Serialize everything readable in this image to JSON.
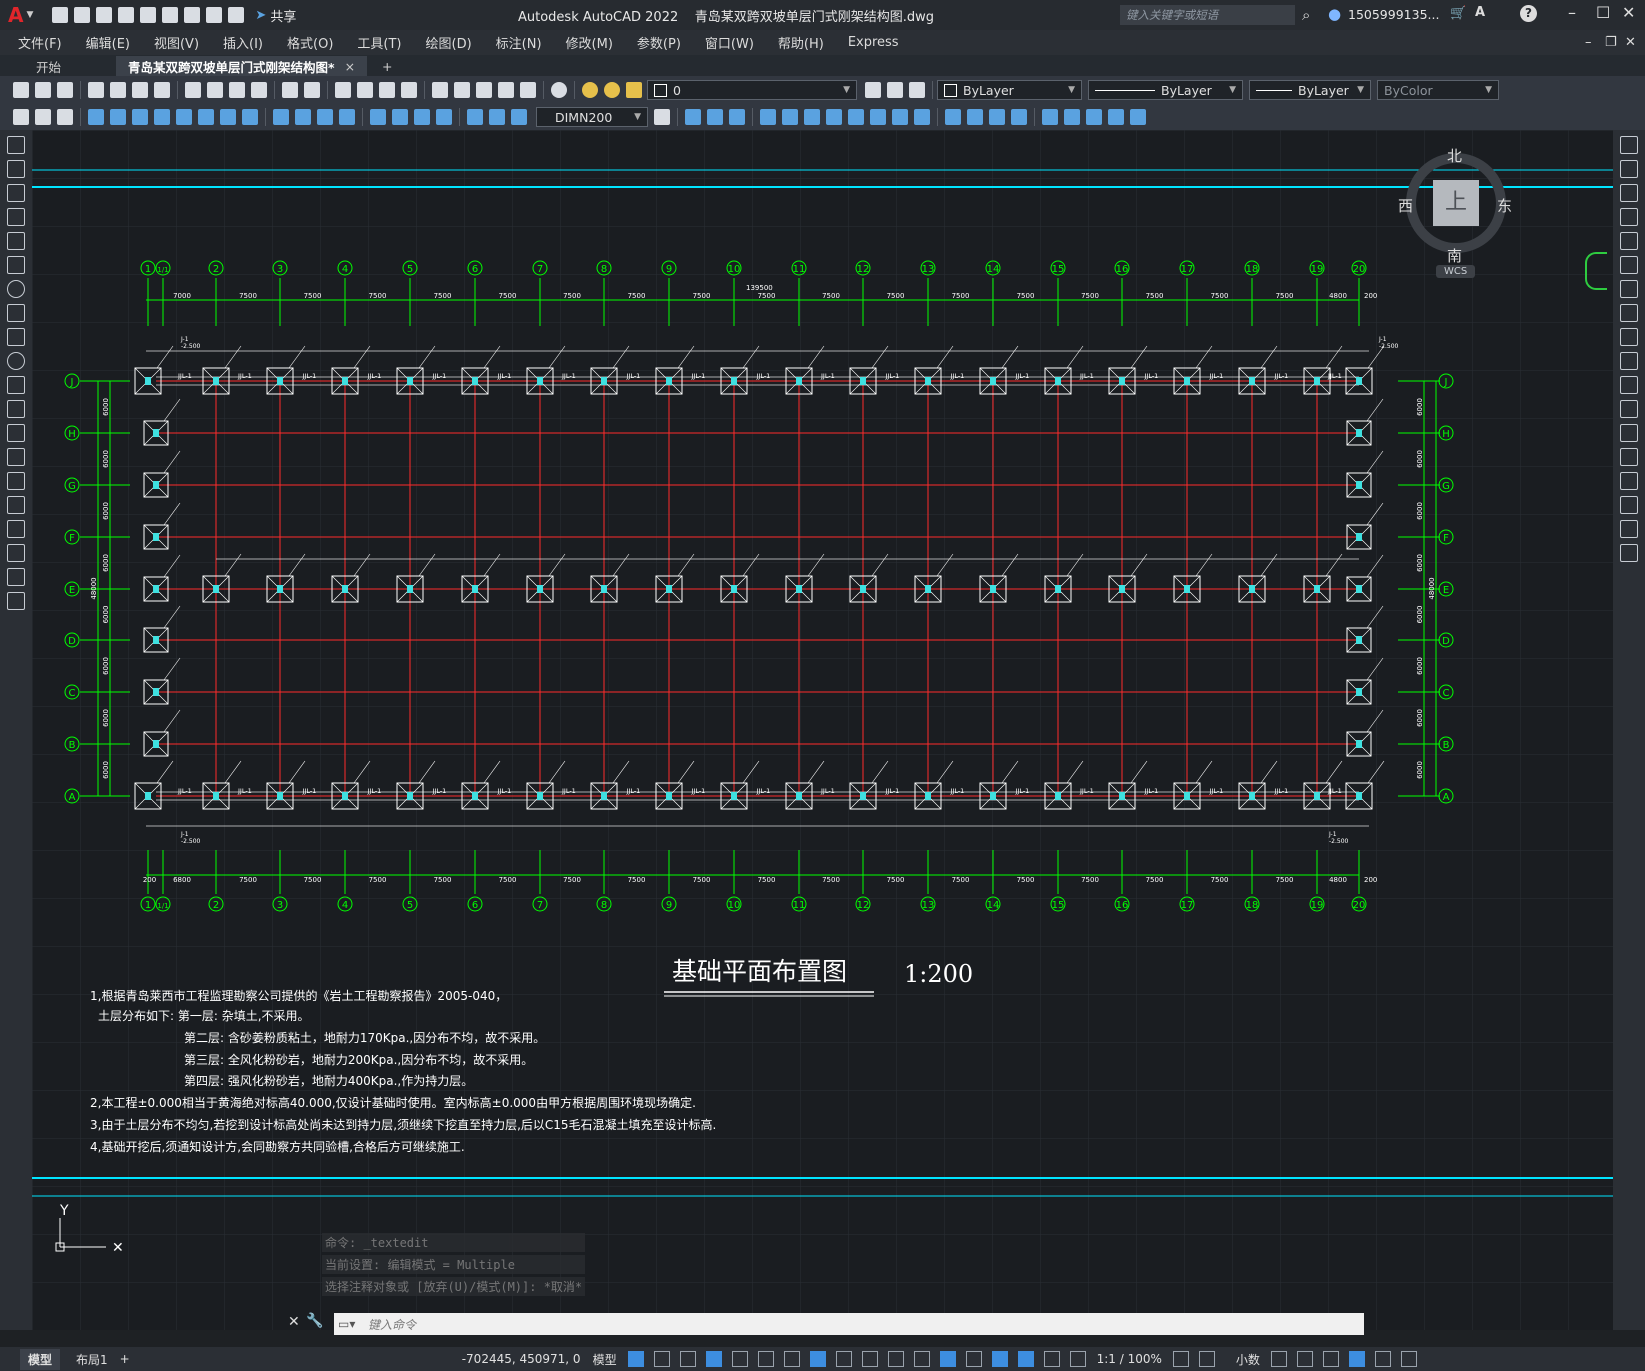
{
  "titlebar": {
    "app_logo": "A",
    "share_label": "共享",
    "title": "Autodesk AutoCAD 2022    青岛某双跨双坡单层门式刚架结构图.dwg",
    "search_placeholder": "键入关键字或短语",
    "user": "1505999135...",
    "help": "?"
  },
  "menubar": {
    "items": [
      "文件(F)",
      "编辑(E)",
      "视图(V)",
      "插入(I)",
      "格式(O)",
      "工具(T)",
      "绘图(D)",
      "标注(N)",
      "修改(M)",
      "参数(P)",
      "窗口(W)",
      "帮助(H)",
      "Express"
    ]
  },
  "tabs": [
    {
      "label": "开始"
    },
    {
      "label": "青岛某双跨双坡单层门式刚架结构图*"
    }
  ],
  "tab_close": "×",
  "tab_add": "+",
  "toolbar": {
    "layer_value": "0",
    "color_value": "ByLayer",
    "linetype_value": "ByLayer",
    "lineweight_value": "ByLayer",
    "plotstyle_value": "ByColor",
    "dimstyle_value": "DIMN200"
  },
  "viewcube": {
    "north": "北",
    "south": "南",
    "east": "东",
    "west": "西",
    "top": "上",
    "wcs": "WCS"
  },
  "drawing": {
    "title": "基础平面布置图",
    "scale": "1:200",
    "total_dim": "139500",
    "grid_columns": [
      "1",
      "1/1",
      "2",
      "3",
      "4",
      "5",
      "6",
      "7",
      "8",
      "9",
      "10",
      "11",
      "12",
      "13",
      "14",
      "15",
      "16",
      "17",
      "18",
      "19",
      "20"
    ],
    "grid_rows": [
      "J",
      "H",
      "G",
      "F",
      "E",
      "D",
      "C",
      "B",
      "A"
    ],
    "top_spans": [
      "7000",
      "7500",
      "7500",
      "7500",
      "7500",
      "7500",
      "7500",
      "7500",
      "7500",
      "7500",
      "7500",
      "7500",
      "7500",
      "7500",
      "7500",
      "7500",
      "7500",
      "7500",
      "4800",
      "200"
    ],
    "bottom_spans": [
      "200",
      "6800",
      "7500",
      "7500",
      "7500",
      "7500",
      "7500",
      "7500",
      "7500",
      "7500",
      "7500",
      "7500",
      "7500",
      "7500",
      "7500",
      "7500",
      "7500",
      "7500",
      "7500",
      "4800",
      "200"
    ],
    "row_spans": [
      "6000",
      "6000",
      "6000",
      "6000",
      "6000",
      "6000",
      "6000",
      "6000"
    ],
    "total_rows_dim": "48000",
    "beam_label": "JJL-1",
    "foundation_label": "J-1",
    "elevation_label": "-2.500",
    "notes": [
      "1,根据青岛莱西市工程监理勘察公司提供的《岩土工程勘察报告》2005-040，",
      "土层分布如下: 第一层: 杂填土,不采用。",
      "第二层: 含砂姜粉质粘土，地耐力170Kpa.,因分布不均，故不采用。",
      "第三层: 全风化粉砂岩，地耐力200Kpa.,因分布不均，故不采用。",
      "第四层: 强风化粉砂岩，地耐力400Kpa.,作为持力层。",
      "2,本工程±0.000相当于黄海绝对标高40.000,仅设计基础时使用。室内标高±0.000由甲方根据周围环境现场确定.",
      "3,由于土层分布不均匀,若挖到设计标高处尚未达到持力层,须继续下挖直至持力层,后以C15毛石混凝土填充至设计标高.",
      "4,基础开挖后,须通知设计方,会同勘察方共同验槽,合格后方可继续施工."
    ]
  },
  "command": {
    "history": [
      "命令: _textedit",
      "当前设置: 编辑模式 = Multiple",
      "选择注释对象或 [放弃(U)/模式(M)]: *取消*"
    ],
    "placeholder": "键入命令"
  },
  "statusbar": {
    "model_tab": "模型",
    "layout_tab": "布局1",
    "add": "+",
    "coords": "-702445, 450971, 0",
    "space": "模型",
    "scale": "1:1 / 100%",
    "units": "小数"
  },
  "colors": {
    "grid_green": "#00ff00",
    "beam_red": "#ff2a2a",
    "foundation_white": "#ffffff",
    "border_cyan": "#00e5ff"
  }
}
